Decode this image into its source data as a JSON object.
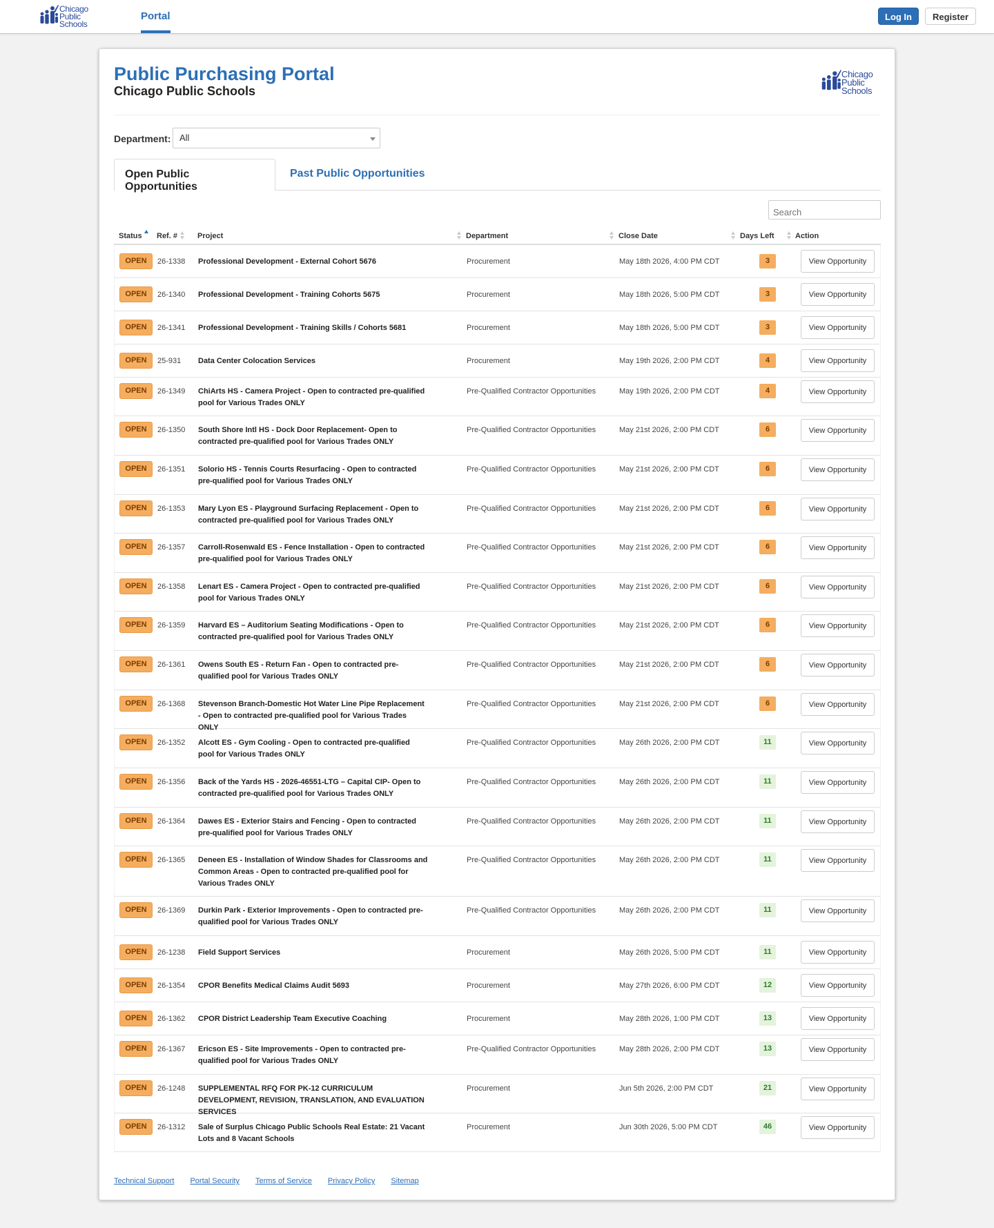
{
  "header": {
    "brand": [
      "Chicago",
      "Public",
      "Schools"
    ],
    "nav_portal": "Portal",
    "login_label": "Log In",
    "register_label": "Register"
  },
  "panel": {
    "title": "Public Purchasing Portal",
    "subtitle": "Chicago Public Schools",
    "logo_text": [
      "Chicago",
      "Public",
      "Schools"
    ]
  },
  "filter": {
    "label": "Department:",
    "value": "All"
  },
  "tabs": [
    {
      "label": "Open Public Opportunities",
      "active": true
    },
    {
      "label": "Past Public Opportunities",
      "active": false
    }
  ],
  "search": {
    "placeholder": "Search"
  },
  "table": {
    "columns": [
      "Status",
      "Ref. #",
      "Project",
      "Department",
      "Close Date",
      "Days Left",
      "Action"
    ],
    "action_label": "View Opportunity",
    "rows": [
      {
        "status": "OPEN",
        "ref": "26-1338",
        "project": "Professional Development - External Cohort 5676",
        "dept": "Procurement",
        "close": "May 18th 2026, 4:00 PM CDT",
        "days": "3",
        "days_color": "orange"
      },
      {
        "status": "OPEN",
        "ref": "26-1340",
        "project": "Professional Development - Training Cohorts 5675",
        "dept": "Procurement",
        "close": "May 18th 2026, 5:00 PM CDT",
        "days": "3",
        "days_color": "orange"
      },
      {
        "status": "OPEN",
        "ref": "26-1341",
        "project": "Professional Development - Training Skills / Cohorts 5681",
        "dept": "Procurement",
        "close": "May 18th 2026, 5:00 PM CDT",
        "days": "3",
        "days_color": "orange"
      },
      {
        "status": "OPEN",
        "ref": "25-931",
        "project": "Data Center Colocation Services",
        "dept": "Procurement",
        "close": "May 19th 2026, 2:00 PM CDT",
        "days": "4",
        "days_color": "orange"
      },
      {
        "status": "OPEN",
        "ref": "26-1349",
        "project": "ChiArts HS - Camera Project - Open to contracted pre-qualified pool for Various Trades ONLY",
        "dept": "Pre-Qualified Contractor Opportunities",
        "close": "May 19th 2026, 2:00 PM CDT",
        "days": "4",
        "days_color": "orange"
      },
      {
        "status": "OPEN",
        "ref": "26-1350",
        "project": "South Shore Intl HS - Dock Door Replacement- Open to contracted pre-qualified pool for Various Trades ONLY",
        "dept": "Pre-Qualified Contractor Opportunities",
        "close": "May 21st 2026, 2:00 PM CDT",
        "days": "6",
        "days_color": "orange"
      },
      {
        "status": "OPEN",
        "ref": "26-1351",
        "project": "Solorio HS - Tennis Courts Resurfacing - Open to contracted pre-qualified pool for Various Trades ONLY",
        "dept": "Pre-Qualified Contractor Opportunities",
        "close": "May 21st 2026, 2:00 PM CDT",
        "days": "6",
        "days_color": "orange"
      },
      {
        "status": "OPEN",
        "ref": "26-1353",
        "project": "Mary Lyon ES - Playground Surfacing Replacement - Open to contracted pre-qualified pool for Various Trades ONLY",
        "dept": "Pre-Qualified Contractor Opportunities",
        "close": "May 21st 2026, 2:00 PM CDT",
        "days": "6",
        "days_color": "orange"
      },
      {
        "status": "OPEN",
        "ref": "26-1357",
        "project": "Carroll-Rosenwald ES - Fence Installation - Open to contracted pre-qualified pool for Various Trades ONLY",
        "dept": "Pre-Qualified Contractor Opportunities",
        "close": "May 21st 2026, 2:00 PM CDT",
        "days": "6",
        "days_color": "orange"
      },
      {
        "status": "OPEN",
        "ref": "26-1358",
        "project": "Lenart ES - Camera Project - Open to contracted pre-qualified pool for Various Trades ONLY",
        "dept": "Pre-Qualified Contractor Opportunities",
        "close": "May 21st 2026, 2:00 PM CDT",
        "days": "6",
        "days_color": "orange"
      },
      {
        "status": "OPEN",
        "ref": "26-1359",
        "project": "Harvard ES – Auditorium Seating Modifications - Open to contracted pre-qualified pool for Various Trades ONLY",
        "dept": "Pre-Qualified Contractor Opportunities",
        "close": "May 21st 2026, 2:00 PM CDT",
        "days": "6",
        "days_color": "orange"
      },
      {
        "status": "OPEN",
        "ref": "26-1361",
        "project": "Owens South ES - Return Fan - Open to contracted pre-qualified pool for Various Trades ONLY",
        "dept": "Pre-Qualified Contractor Opportunities",
        "close": "May 21st 2026, 2:00 PM CDT",
        "days": "6",
        "days_color": "orange"
      },
      {
        "status": "OPEN",
        "ref": "26-1368",
        "project": "Stevenson Branch-Domestic Hot Water Line Pipe Replacement - Open to contracted pre-qualified pool for Various Trades ONLY",
        "dept": "Pre-Qualified Contractor Opportunities",
        "close": "May 21st 2026, 2:00 PM CDT",
        "days": "6",
        "days_color": "orange"
      },
      {
        "status": "OPEN",
        "ref": "26-1352",
        "project": "Alcott ES - Gym Cooling - Open to contracted pre-qualified pool for Various Trades ONLY",
        "dept": "Pre-Qualified Contractor Opportunities",
        "close": "May 26th 2026, 2:00 PM CDT",
        "days": "11",
        "days_color": "green"
      },
      {
        "status": "OPEN",
        "ref": "26-1356",
        "project": "Back of the Yards HS - 2026-46551-LTG – Capital CIP- Open to contracted pre-qualified pool for Various Trades ONLY",
        "dept": "Pre-Qualified Contractor Opportunities",
        "close": "May 26th 2026, 2:00 PM CDT",
        "days": "11",
        "days_color": "green"
      },
      {
        "status": "OPEN",
        "ref": "26-1364",
        "project": "Dawes ES - Exterior Stairs and Fencing - Open to contracted pre-qualified pool for Various Trades ONLY",
        "dept": "Pre-Qualified Contractor Opportunities",
        "close": "May 26th 2026, 2:00 PM CDT",
        "days": "11",
        "days_color": "green"
      },
      {
        "status": "OPEN",
        "ref": "26-1365",
        "project": "Deneen ES - Installation of Window Shades for Classrooms and Common Areas - Open to contracted pre-qualified pool for Various Trades ONLY",
        "dept": "Pre-Qualified Contractor Opportunities",
        "close": "May 26th 2026, 2:00 PM CDT",
        "days": "11",
        "days_color": "green"
      },
      {
        "status": "OPEN",
        "ref": "26-1369",
        "project": "Durkin Park - Exterior Improvements - Open to contracted pre-qualified pool for Various Trades ONLY",
        "dept": "Pre-Qualified Contractor Opportunities",
        "close": "May 26th 2026, 2:00 PM CDT",
        "days": "11",
        "days_color": "green"
      },
      {
        "status": "OPEN",
        "ref": "26-1238",
        "project": "Field Support Services",
        "dept": "Procurement",
        "close": "May 26th 2026, 5:00 PM CDT",
        "days": "11",
        "days_color": "green"
      },
      {
        "status": "OPEN",
        "ref": "26-1354",
        "project": "CPOR Benefits Medical Claims Audit 5693",
        "dept": "Procurement",
        "close": "May 27th 2026, 6:00 PM CDT",
        "days": "12",
        "days_color": "green"
      },
      {
        "status": "OPEN",
        "ref": "26-1362",
        "project": "CPOR District Leadership Team Executive Coaching",
        "dept": "Procurement",
        "close": "May 28th 2026, 1:00 PM CDT",
        "days": "13",
        "days_color": "green"
      },
      {
        "status": "OPEN",
        "ref": "26-1367",
        "project": "Ericson ES - Site Improvements - Open to contracted pre-qualified pool for Various Trades ONLY",
        "dept": "Pre-Qualified Contractor Opportunities",
        "close": "May 28th 2026, 2:00 PM CDT",
        "days": "13",
        "days_color": "green"
      },
      {
        "status": "OPEN",
        "ref": "26-1248",
        "project": "SUPPLEMENTAL RFQ FOR PK-12 CURRICULUM DEVELOPMENT, REVISION, TRANSLATION, AND EVALUATION SERVICES",
        "dept": "Procurement",
        "close": "Jun 5th 2026, 2:00 PM CDT",
        "days": "21",
        "days_color": "green"
      },
      {
        "status": "OPEN",
        "ref": "26-1312",
        "project": "Sale of Surplus Chicago Public Schools Real Estate: 21 Vacant Lots and 8 Vacant Schools",
        "dept": "Procurement",
        "close": "Jun 30th 2026, 5:00 PM CDT",
        "days": "46",
        "days_color": "green"
      }
    ]
  },
  "footer": {
    "links": [
      "Technical Support",
      "Portal Security",
      "Terms of Service",
      "Privacy Policy",
      "Sitemap"
    ]
  }
}
